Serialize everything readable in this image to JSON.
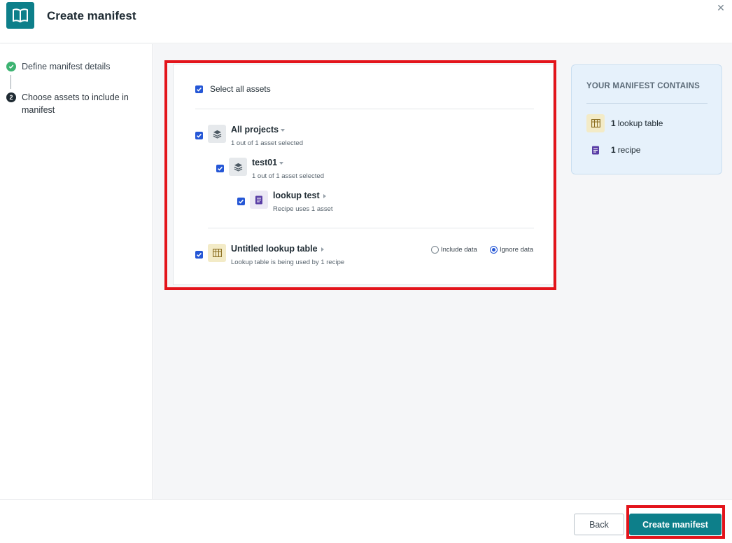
{
  "header": {
    "title": "Create manifest",
    "close_glyph": "✕",
    "logo_icon": "book-icon",
    "brand_color": "#0d7f8a"
  },
  "sidebar": {
    "steps": [
      {
        "label": "Define manifest details",
        "status": "done"
      },
      {
        "number": "2",
        "label": "Choose assets to include in manifest",
        "status": "current"
      }
    ]
  },
  "assets": {
    "select_all_label": "Select all assets",
    "tree": {
      "all_projects": {
        "label": "All projects",
        "subtitle": "1 out of 1 asset selected",
        "checked": true
      },
      "test01": {
        "label": "test01",
        "subtitle": "1 out of 1 asset selected",
        "checked": true
      },
      "lookup_test": {
        "label": "lookup test",
        "subtitle": "Recipe uses 1 asset",
        "checked": true
      }
    },
    "lookup_table": {
      "label": "Untitled lookup table",
      "subtitle": "Lookup table is being used by 1 recipe",
      "checked": true,
      "options": [
        {
          "label": "Include data",
          "selected": false
        },
        {
          "label": "Ignore data",
          "selected": true
        }
      ]
    }
  },
  "summary": {
    "title": "YOUR MANIFEST CONTAINS",
    "items": [
      {
        "count": "1",
        "label": "lookup table",
        "icon": "table-icon"
      },
      {
        "count": "1",
        "label": "recipe",
        "icon": "recipe-icon"
      }
    ]
  },
  "footer": {
    "back_label": "Back",
    "create_label": "Create manifest"
  },
  "colors": {
    "accent": "#0d7f8a",
    "checkbox": "#2557d6",
    "highlight": "#e3141b",
    "done": "#3cb371"
  }
}
